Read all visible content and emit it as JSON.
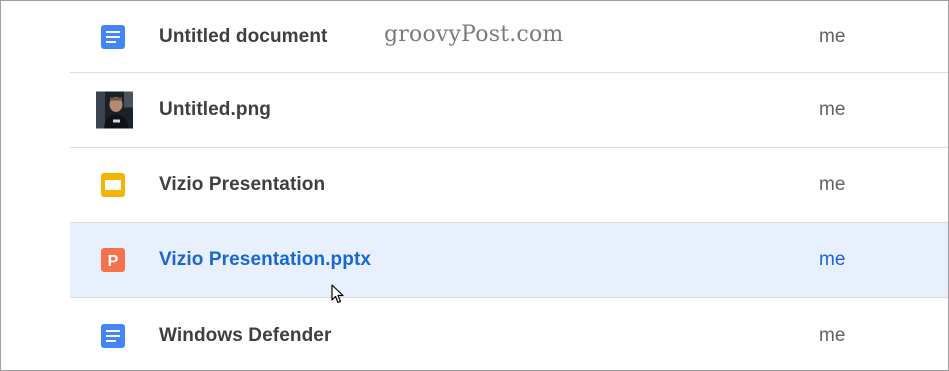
{
  "watermark": "groovyPost.com",
  "files": [
    {
      "name": "Untitled document",
      "owner": "me",
      "icon": "google-docs-icon",
      "color": "#4285f4"
    },
    {
      "name": "Untitled.png",
      "owner": "me",
      "icon": "image-thumbnail"
    },
    {
      "name": "Vizio Presentation",
      "owner": "me",
      "icon": "google-slides-icon",
      "color": "#f4b400"
    },
    {
      "name": "Vizio Presentation.pptx",
      "owner": "me",
      "icon": "powerpoint-icon",
      "color": "#f4734c",
      "icon_letter": "P",
      "selected": true
    },
    {
      "name": "Windows Defender",
      "owner": "me",
      "icon": "google-docs-icon",
      "color": "#4285f4"
    }
  ],
  "colors": {
    "selected_bg": "#e8f0fe",
    "selected_text": "#1967d2",
    "text": "#3c4043",
    "divider": "#dadce0"
  }
}
